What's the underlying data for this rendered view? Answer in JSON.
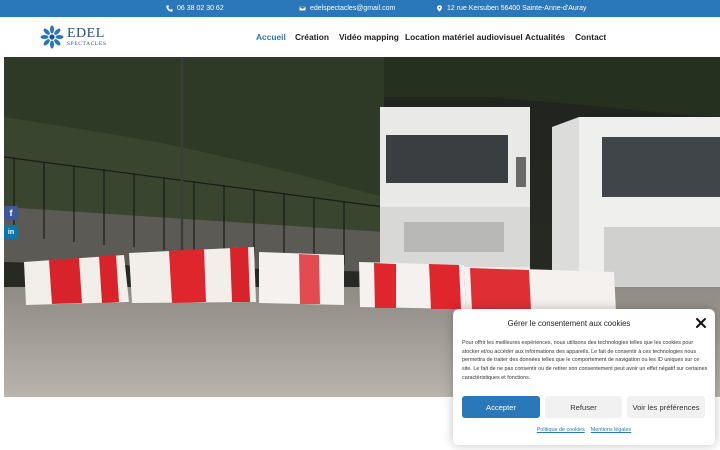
{
  "topbar": {
    "phone": "06 38 02 30 62",
    "email": "edelspectacles@gmail.com",
    "address": "12 rue Kersuben 56400 Sainte-Anne-d'Auray"
  },
  "logo": {
    "brand": "EDEL",
    "sub": "SPECTACLES"
  },
  "nav": {
    "items": [
      {
        "label": "Accueil"
      },
      {
        "label": "Création"
      },
      {
        "label": "Vidéo mapping"
      },
      {
        "label": "Location matériel audiovisuel"
      },
      {
        "label": "Actualités"
      },
      {
        "label": "Contact"
      }
    ]
  },
  "social": {
    "facebook": "f",
    "linkedin": "in"
  },
  "cookie": {
    "title": "Gérer le consentement aux cookies",
    "body": "Pour offrir les meilleures expériences, nous utilisons des technologies telles que les cookies pour stocker et/ou accéder aux informations des appareils. Le fait de consentir à ces technologies nous permettra de traiter des données telles que le comportement de navigation ou les ID uniques sur ce site. Le fait de ne pas consentir ou de retirer son consentement peut avoir un effet négatif sur certaines caractéristiques et fonctions.",
    "accept": "Accepter",
    "refuse": "Refuser",
    "prefs": "Voir les préférences",
    "link_cookies": "Politique de cookies",
    "link_legal": "Mentions légales"
  },
  "colors": {
    "accent": "#2a78b9",
    "topbar": "#2a78b9",
    "dark_text": "#222222"
  }
}
